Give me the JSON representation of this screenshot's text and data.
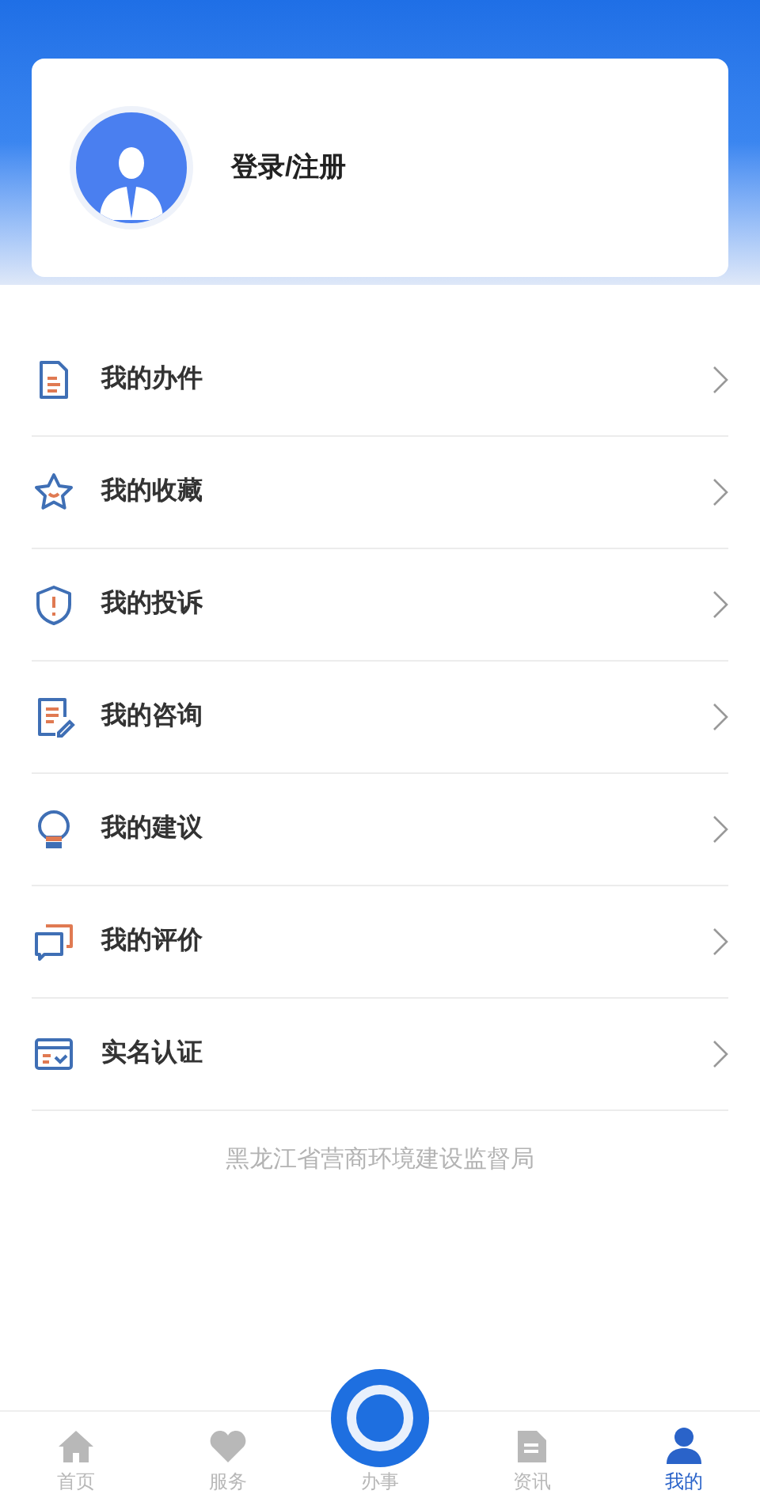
{
  "profile": {
    "login_label": "登录/注册"
  },
  "menu": [
    {
      "label": "我的办件"
    },
    {
      "label": "我的收藏"
    },
    {
      "label": "我的投诉"
    },
    {
      "label": "我的咨询"
    },
    {
      "label": "我的建议"
    },
    {
      "label": "我的评价"
    },
    {
      "label": "实名认证"
    }
  ],
  "footer_text": "黑龙江省营商环境建设监督局",
  "tab_bar": [
    {
      "label": "首页",
      "kind": "tab",
      "selected": false
    },
    {
      "label": "服务",
      "kind": "tab",
      "selected": false
    },
    {
      "label": "办事",
      "kind": "center",
      "selected": false
    },
    {
      "label": "资讯",
      "kind": "tab",
      "selected": false
    },
    {
      "label": "我的",
      "kind": "tab",
      "selected": true
    }
  ]
}
